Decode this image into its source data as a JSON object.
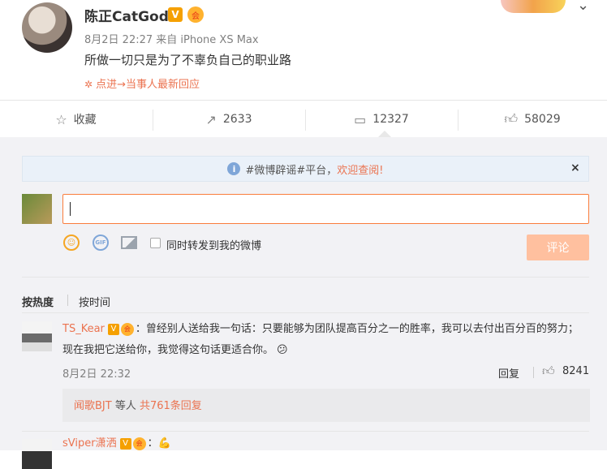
{
  "post": {
    "username": "陈正CatGod",
    "v_badge": "V",
    "level_badge": "会",
    "meta": "8月2日 22:27 来自 iPhone XS Max",
    "text": "所做一切只是为了不辜负自己的职业路",
    "hot_link": "点进→当事人最新回应",
    "menu_icon": "chevron-down-icon"
  },
  "actions": {
    "favorite": "收藏",
    "repost_count": "2633",
    "comment_count": "12327",
    "like_count": "58029"
  },
  "notice": {
    "prefix": "#微博辟谣#平台，",
    "highlight": "欢迎查阅!",
    "close": "×"
  },
  "composer": {
    "repost_label": "同时转发到我的微博",
    "submit_label": "评论",
    "emoji_label": "☺",
    "gif_label": "GIF"
  },
  "sort": {
    "hot": "按热度",
    "time": "按时间"
  },
  "comments": [
    {
      "user": "TS_Kear",
      "v": "V",
      "level": "会",
      "text": "：曾经别人送给我一句话：只要能够为团队提高百分之一的胜率，我可以去付出百分百的努力；  现在我把它送给你，我觉得这句话更适合你。",
      "emoji": "😕",
      "time": "8月2日 22:32",
      "reply": "回复",
      "likes": "8241",
      "sub_user": "闻歌BJT",
      "sub_mid": " 等人 ",
      "sub_link": "共761条回复"
    },
    {
      "user": "sViper潇洒",
      "v": "V",
      "level": "会",
      "text": "：",
      "emoji": "💪"
    }
  ],
  "colors": {
    "accent": "#eb7350",
    "input_border": "#fa7d3c",
    "submit_disabled": "#ffc09f"
  }
}
